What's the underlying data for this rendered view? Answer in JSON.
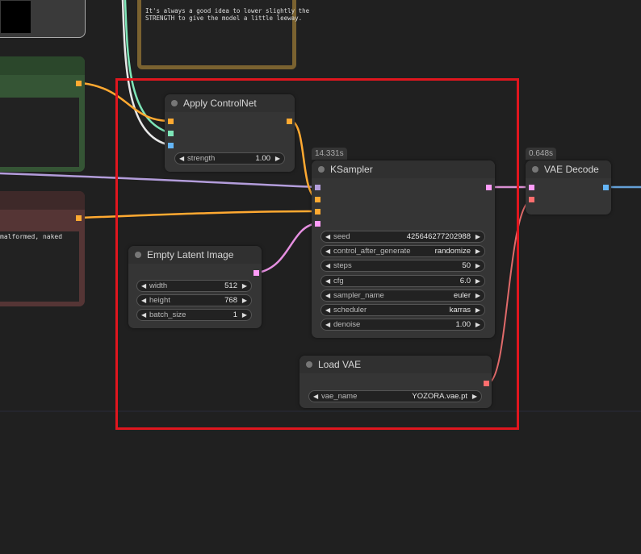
{
  "note": {
    "text": "It's always a good idea to lower slightly the\nSTRENGTH to give the model a little leeway."
  },
  "negative_prompt_fragment": "malformed, naked",
  "nodes": {
    "apply_controlnet": {
      "title": "Apply ControlNet",
      "widgets": [
        {
          "name": "strength",
          "value": "1.00"
        }
      ]
    },
    "ksampler": {
      "title": "KSampler",
      "time": "14.331s",
      "widgets": [
        {
          "name": "seed",
          "value": "425646277202988"
        },
        {
          "name": "control_after_generate",
          "value": "randomize"
        },
        {
          "name": "steps",
          "value": "50"
        },
        {
          "name": "cfg",
          "value": "6.0"
        },
        {
          "name": "sampler_name",
          "value": "euler"
        },
        {
          "name": "scheduler",
          "value": "karras"
        },
        {
          "name": "denoise",
          "value": "1.00"
        }
      ]
    },
    "empty_latent": {
      "title": "Empty Latent Image",
      "widgets": [
        {
          "name": "width",
          "value": "512"
        },
        {
          "name": "height",
          "value": "768"
        },
        {
          "name": "batch_size",
          "value": "1"
        }
      ]
    },
    "vae_decode": {
      "title": "VAE Decode",
      "time": "0.648s"
    },
    "load_vae": {
      "title": "Load VAE",
      "widgets": [
        {
          "name": "vae_name",
          "value": "YOZORA.vae.pt"
        }
      ]
    }
  },
  "colors": {
    "highlight": "#e0161e",
    "model": "#b39ddb",
    "conditioning": "#ffa931",
    "latent": "#ff9cf9",
    "vae": "#ff6e6e",
    "image": "#64b5f6",
    "control_net": "#7ee6b8"
  }
}
